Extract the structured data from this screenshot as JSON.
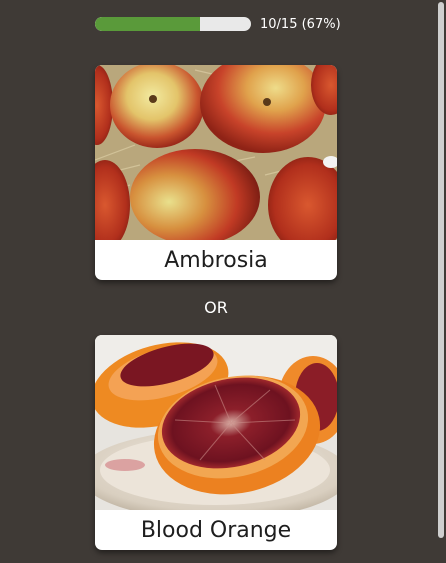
{
  "progress": {
    "text": "10/15 (67%)",
    "fraction": 0.67,
    "fill_color": "#5a9a3a",
    "track_color": "#e9e9e9"
  },
  "choices": [
    {
      "label": "Ambrosia",
      "image": "apple-photo"
    },
    {
      "label": "Blood Orange",
      "image": "blood-orange-photo"
    }
  ],
  "separator": "OR",
  "colors": {
    "background": "#3f3a36",
    "card": "#ffffff"
  }
}
